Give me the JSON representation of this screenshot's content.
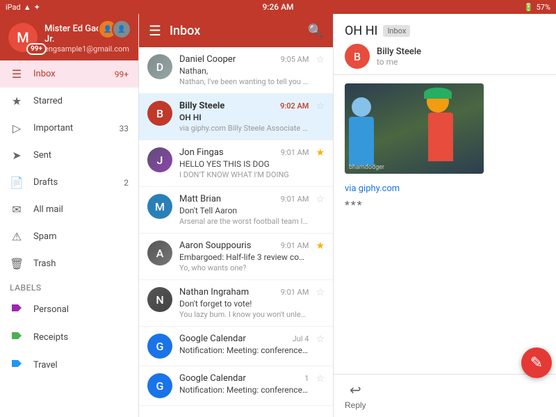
{
  "statusBar": {
    "left": "iPad",
    "time": "9:26 AM",
    "battery": "57%",
    "wifi": "wifi-icon",
    "bluetooth": "bluetooth-icon"
  },
  "sidebar": {
    "user": {
      "name": "Mister Ed Gadgeteer, Jr.",
      "email": "engsample1@gmail.com",
      "avatarLetter": "M",
      "unreadBadge": "99+"
    },
    "navItems": [
      {
        "id": "inbox",
        "label": "Inbox",
        "icon": "☰",
        "count": "99+",
        "active": true
      },
      {
        "id": "starred",
        "label": "Starred",
        "icon": "★",
        "count": "",
        "active": false
      },
      {
        "id": "important",
        "label": "Important",
        "icon": "▷",
        "count": "33",
        "active": false
      },
      {
        "id": "sent",
        "label": "Sent",
        "icon": "➤",
        "count": "",
        "active": false
      },
      {
        "id": "drafts",
        "label": "Drafts",
        "icon": "📄",
        "count": "2",
        "active": false
      },
      {
        "id": "allmail",
        "label": "All mail",
        "icon": "✉",
        "count": "",
        "active": false
      },
      {
        "id": "spam",
        "label": "Spam",
        "icon": "⚠",
        "count": "",
        "active": false
      },
      {
        "id": "trash",
        "label": "Trash",
        "icon": "🗑",
        "count": "",
        "active": false
      }
    ],
    "labelsTitle": "Labels",
    "labelItems": [
      {
        "id": "personal",
        "label": "Personal",
        "color": "#9c27b0"
      },
      {
        "id": "receipts",
        "label": "Receipts",
        "color": "#4caf50"
      },
      {
        "id": "travel",
        "label": "Travel",
        "color": "#2196f3"
      }
    ]
  },
  "emailList": {
    "headerTitle": "Inbox",
    "emails": [
      {
        "id": "1",
        "sender": "Daniel Cooper",
        "time": "9:05 AM",
        "subject": "Nathan,",
        "preview": "Nathan, I've been wanting to tell you thi...",
        "avatarLetter": "D",
        "avatarClass": "avatar-daniel",
        "starred": false,
        "unread": false,
        "selected": false
      },
      {
        "id": "2",
        "sender": "Billy Steele",
        "time": "9:02 AM",
        "subject": "OH HI",
        "preview": "via giphy.com Billy Steele Associate Edi...",
        "avatarLetter": "B",
        "avatarClass": "avatar-billy",
        "starred": false,
        "unread": true,
        "selected": true
      },
      {
        "id": "3",
        "sender": "Jon Fingas",
        "time": "9:01 AM",
        "subject": "HELLO YES THIS IS DOG",
        "preview": "I DON'T KNOW WHAT I'M DOING",
        "avatarLetter": "J",
        "avatarClass": "avatar-jon",
        "starred": true,
        "unread": false,
        "selected": false
      },
      {
        "id": "4",
        "sender": "Matt Brian",
        "time": "9:01 AM",
        "subject": "Don't Tell Aaron",
        "preview": "Arsenal are the worst football team I've...",
        "avatarLetter": "M",
        "avatarClass": "avatar-matt",
        "starred": false,
        "unread": false,
        "selected": false
      },
      {
        "id": "5",
        "sender": "Aaron Souppouris",
        "time": "9:01 AM",
        "subject": "Embargoed: Half-life 3 review codes",
        "preview": "Yo, who wants one?",
        "avatarLetter": "A",
        "avatarClass": "avatar-aaron",
        "starred": true,
        "unread": false,
        "selected": false
      },
      {
        "id": "6",
        "sender": "Nathan Ingraham",
        "time": "9:01 AM",
        "subject": "Don't forget to vote!",
        "preview": "You lazy bum. I know you won't unless...",
        "avatarLetter": "N",
        "avatarClass": "avatar-nathan",
        "starred": false,
        "unread": false,
        "selected": false
      },
      {
        "id": "7",
        "sender": "Google Calendar",
        "time": "Jul 4",
        "subject": "Notification: Meeting: conference ro...",
        "preview": "",
        "avatarLetter": "G",
        "avatarClass": "avatar-gcal",
        "starred": false,
        "unread": false,
        "selected": false
      },
      {
        "id": "8",
        "sender": "Google Calendar",
        "time": "1",
        "subject": "Notification: Meeting: conference r...",
        "preview": "",
        "avatarLetter": "G",
        "avatarClass": "avatar-gcal2",
        "starred": false,
        "unread": false,
        "selected": false
      }
    ]
  },
  "emailDetail": {
    "subject": "OH HI",
    "inboxBadge": "Inbox",
    "senderName": "Billy Steele",
    "senderAvatarLetter": "B",
    "toLabel": "to me",
    "giphyLink": "via giphy.com",
    "imageWatermark": "bhamdodger",
    "dots": "***",
    "replyLabel": "Reply"
  },
  "fab": {
    "icon": "✎",
    "label": "compose"
  }
}
